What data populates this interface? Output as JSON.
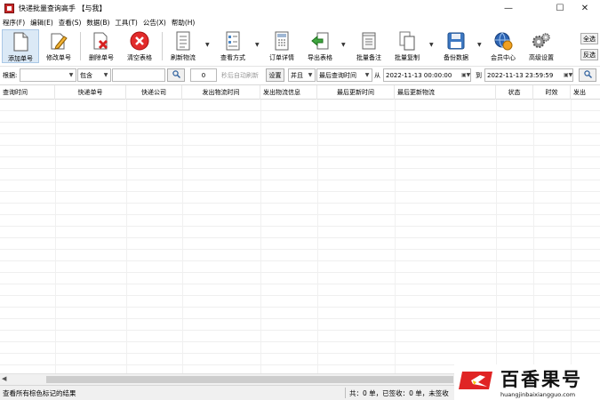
{
  "window": {
    "title": "快递批量查询高手 【与我】",
    "controls": {
      "minimize": "—",
      "maximize": "☐",
      "close": "✕"
    }
  },
  "menu": [
    "程序(F)",
    "编辑(E)",
    "查看(S)",
    "数据(B)",
    "工具(T)",
    "公告(X)",
    "帮助(H)"
  ],
  "toolbar": {
    "add": "添加单号",
    "edit": "修改单号",
    "delete": "删除单号",
    "clear": "清空表格",
    "refresh": "刷新物流",
    "view_mode": "查看方式",
    "order_detail": "订单详情",
    "export": "导出表格",
    "batch_note": "批量备注",
    "batch_copy": "批量复制",
    "backup": "备份数据",
    "member": "会员中心",
    "advanced": "高级设置",
    "select_all": "全选",
    "invert": "反选"
  },
  "filter": {
    "label": "根据:",
    "field_value": "",
    "match_value": "包含",
    "keyword": "",
    "interval": "0",
    "auto_refresh_label": "秒后自动刷新",
    "settings": "设置",
    "logic_value": "并且",
    "time_field_value": "最后查询时间",
    "from_label": "从",
    "from_value": "2022-11-13 00:00:00",
    "to_label": "到",
    "to_value": "2022-11-13 23:59:59",
    "search_icon": "search-icon"
  },
  "table": {
    "columns": [
      "查询时间",
      "快递单号",
      "快递公司",
      "发出物流时间",
      "发出物流信息",
      "最后更新时间",
      "最后更新物流",
      "状态",
      "时效",
      "发出"
    ]
  },
  "status": {
    "left": "查看所有棕色标记的结果",
    "right": "共：0 单，已签收：0 单，未签收"
  },
  "watermark": {
    "name": "百香果号",
    "url": "huangjinbaixiangguo.com"
  }
}
